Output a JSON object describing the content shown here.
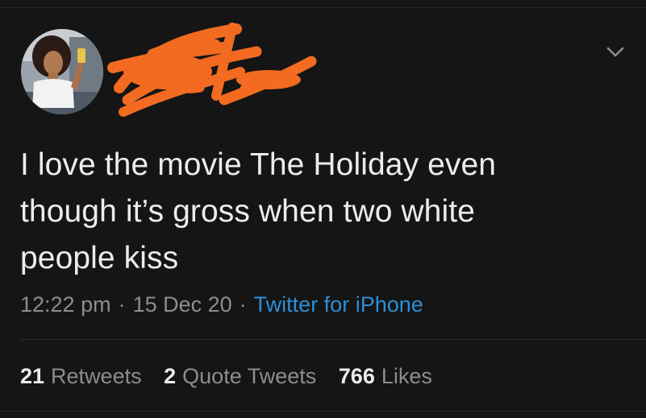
{
  "tweet": {
    "text_lines": [
      "I love the movie The Holiday even",
      "though it’s gross when two white",
      "people kiss"
    ],
    "time": "12:22 pm",
    "separator": "·",
    "date": "15 Dec 20",
    "source": "Twitter for iPhone"
  },
  "stats": [
    {
      "count": "21",
      "label": "Retweets"
    },
    {
      "count": "2",
      "label": "Quote Tweets"
    },
    {
      "count": "766",
      "label": "Likes"
    }
  ],
  "icons": {
    "menu": "chevron-down-icon",
    "redaction": "redaction-scribble"
  },
  "colors": {
    "background": "#151515",
    "text": "#ececec",
    "muted": "#8a8d91",
    "link": "#2b8fd6",
    "redaction": "#f26b21"
  }
}
